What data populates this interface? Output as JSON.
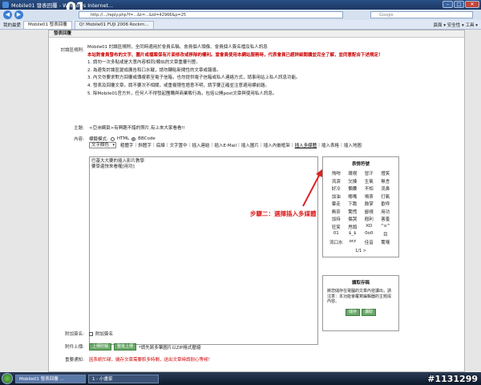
{
  "window": {
    "title": "Mobile01 發表回覆 - Windows Internet...",
    "logo": "01"
  },
  "address": {
    "url": "http://.../reply.php?f=...&t=...&id=42966&p=25",
    "search_placeholder": "Google"
  },
  "tabs": {
    "favorites": "我的最愛",
    "items": [
      "Mobile01 發表回覆",
      "Q! Mobile01 FUJI 2006 Rockm..."
    ],
    "tools": "頁面 ▾  安全性 ▾  工具 ▾"
  },
  "panel": {
    "header": "發表回覆"
  },
  "rules": {
    "label": "討論區規則:",
    "line1": "Mobile01 討論區規則，全同時適用於會員名稱、會員個人頭像、會員個人簽名檔及私人訊息",
    "warning": "本站對會員發布的文字、圖片或檔案保有片面修改或移除的權利。當會員使用本網站服務時，代表會員已經詳細閱讀並完全了解，並同意配合下述規定！",
    "items": [
      "1. 請勿一次多貼或是大意內容相同/類似的文章重覆刊登。",
      "2. 為避免討論區變成廣告和口水戰，請勿轉貼新聞性的文章或報導。",
      "3. 內文勿要求對方回覆或傳複索至電子信箱，也勿提供電子信箱或私人連絡方式，請事用站上私人訊息功能。",
      "4. 發表及回覆文章，請不要次不相關，或重複隱性語意不明，請字要正確並注意適用標前題。",
      "5. 除Mobile01官方外，任何人不得發起團購與商業販行為，包括公開post文章與使用私人訊息。"
    ]
  },
  "subject": {
    "label": "主題:",
    "value": "<亞洲網頁>有興趣不錯的照片,有上來大家看看!!"
  },
  "content": {
    "label": "內容:",
    "mode_label": "標籤模式:",
    "modes": [
      "HTML",
      "BBCode"
    ],
    "color_select": "文字顏色",
    "toolbar": [
      "粗體字",
      "斜體字",
      "底線",
      "文字置中",
      "插入連結",
      "插入E-Mail",
      "插入圖片",
      "插入內嵌框架",
      "插入多媒體",
      "插入表格",
      "插入地圖"
    ],
    "editor_text": [
      "巴基大大要的插入影片教學",
      "要學還快來看喔[用功]"
    ]
  },
  "smilies": {
    "title": "表情符號",
    "items": [
      "飛吻",
      "環視",
      "冒汗",
      "燈笑",
      "流淚",
      "欠揍",
      "生氣",
      "無言",
      "好冷",
      "懶腰",
      "不知",
      "流鼻",
      "加油",
      "嘟嘴",
      "噴茶",
      "打氣",
      "暈走",
      "下跪",
      "鼓掌",
      "歡呼",
      "無奈",
      "驚慌",
      "鄙視",
      "用功",
      "加持",
      "傷哭",
      "翹利",
      "害羞",
      "狂笑",
      "甩頭",
      "XD",
      "^o^",
      "01",
      "$_$",
      "0o0",
      "目",
      "流口水",
      "orz",
      "佳音",
      "驚嘆"
    ],
    "pager": "1/1 >"
  },
  "draft": {
    "title": "讀取存稿",
    "text": "將您儲存在電腦的文章內容讀出，請注意：本功能會覆寫編輯器的主題與內容。",
    "buttons": [
      "儲存",
      "讀取"
    ]
  },
  "annotation": "步驟二：選擇插入多媒體",
  "signature": {
    "label": "附加簽名:",
    "checkbox": "附加簽名"
  },
  "attach": {
    "label": "附件上傳:",
    "buttons": [
      "上傳附檔",
      "整批上傳"
    ],
    "note": "*請先將多筆圖片以ZIP格式壓縮"
  },
  "notice": {
    "label": "重要通知:",
    "text": "因系統忙碌，儲存文章需要較多時間，送出文章時請耐心等候！"
  },
  "taskbar": {
    "items": [
      "Mobile01 發表回覆 ...",
      "1 - 小畫家"
    ]
  },
  "watermark": "#1131299",
  "colors": {
    "warning": "#cc0000",
    "annotation": "#e02020"
  }
}
